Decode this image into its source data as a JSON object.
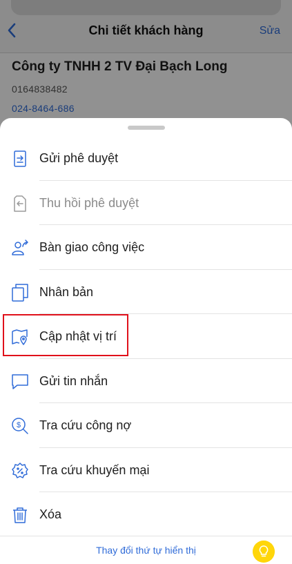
{
  "header": {
    "title": "Chi tiết khách hàng",
    "edit_label": "Sửa"
  },
  "customer": {
    "name": "Công ty TNHH 2 TV Đại Bạch Long",
    "code": "0164838482",
    "phone": "024-8464-686"
  },
  "menu": [
    {
      "label": "Gửi phê duyệt",
      "icon": "send-approval-icon",
      "enabled": true
    },
    {
      "label": "Thu hồi phê duyệt",
      "icon": "revoke-approval-icon",
      "enabled": false
    },
    {
      "label": "Bàn giao công việc",
      "icon": "handover-icon",
      "enabled": true
    },
    {
      "label": "Nhân bản",
      "icon": "duplicate-icon",
      "enabled": true
    },
    {
      "label": "Cập nhật vị trí",
      "icon": "map-location-icon",
      "enabled": true,
      "highlighted": true
    },
    {
      "label": "Gửi tin nhắn",
      "icon": "message-icon",
      "enabled": true
    },
    {
      "label": "Tra cứu công nợ",
      "icon": "debt-search-icon",
      "enabled": true
    },
    {
      "label": "Tra cứu khuyến mại",
      "icon": "promotion-icon",
      "enabled": true
    },
    {
      "label": "Xóa",
      "icon": "trash-icon",
      "enabled": true
    }
  ],
  "footer": {
    "reorder_label": "Thay đổi thứ tự hiển thị",
    "hint_icon": "lightbulb-icon"
  },
  "colors": {
    "accent": "#2f6bd8",
    "highlight": "#e0101a",
    "bulb": "#ffd60a"
  }
}
